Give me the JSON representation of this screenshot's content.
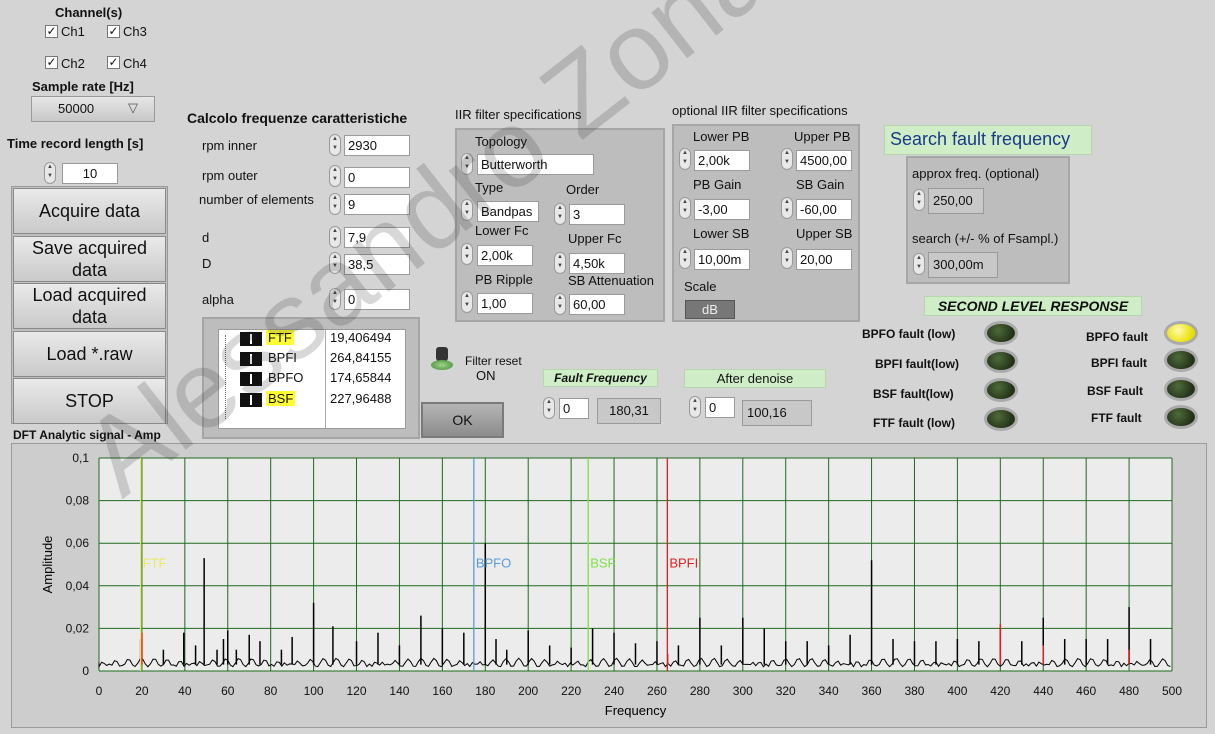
{
  "channels": {
    "title": "Channel(s)",
    "items": [
      {
        "label": "Ch1",
        "checked": true
      },
      {
        "label": "Ch3",
        "checked": true
      },
      {
        "label": "Ch2",
        "checked": true
      },
      {
        "label": "Ch4",
        "checked": true
      }
    ]
  },
  "sample_rate": {
    "label": "Sample rate [Hz]",
    "value": "50000"
  },
  "time_record": {
    "label": "Time record length [s]",
    "value": "10"
  },
  "buttons": {
    "acquire": "Acquire data",
    "save": "Save acquired data",
    "load": "Load acquired data",
    "load_raw": "Load *.raw",
    "stop": "STOP",
    "ok": "OK"
  },
  "calc": {
    "title": "Calcolo frequenze caratteristiche",
    "rpm_inner_label": "rpm inner",
    "rpm_inner": "2930",
    "rpm_outer_label": "rpm outer",
    "rpm_outer": "0",
    "elements_label": "number of elements",
    "elements": "9",
    "d_label": "d",
    "d": "7,9",
    "D_label": "D",
    "D": "38,5",
    "alpha_label": "alpha",
    "alpha": "0"
  },
  "freq_table": [
    {
      "name": "FTF",
      "value": "19,406494",
      "highlight": true
    },
    {
      "name": "BPFI",
      "value": "264,84155",
      "highlight": false
    },
    {
      "name": "BPFO",
      "value": "174,65844",
      "highlight": false
    },
    {
      "name": "BSF",
      "value": "227,96488",
      "highlight": true
    }
  ],
  "iir": {
    "title": "IIR filter specifications",
    "topology_label": "Topology",
    "topology": "Butterworth",
    "type_label": "Type",
    "type": "Bandpas",
    "order_label": "Order",
    "order": "3",
    "lower_fc_label": "Lower Fc",
    "lower_fc": "2,00k",
    "upper_fc_label": "Upper Fc",
    "upper_fc": "4,50k",
    "pb_ripple_label": "PB Ripple",
    "pb_ripple": "1,00",
    "sb_att_label": "SB Attenuation",
    "sb_att": "60,00"
  },
  "opt_iir": {
    "title": "optional IIR filter specifications",
    "lower_pb_label": "Lower PB",
    "lower_pb": "2,00k",
    "upper_pb_label": "Upper PB",
    "upper_pb": "4500,00",
    "pb_gain_label": "PB Gain",
    "pb_gain": "-3,00",
    "sb_gain_label": "SB Gain",
    "sb_gain": "-60,00",
    "lower_sb_label": "Lower SB",
    "lower_sb": "10,00m",
    "upper_sb_label": "Upper SB",
    "upper_sb": "20,00",
    "scale_label": "Scale",
    "scale": "dB"
  },
  "filter_reset": {
    "label": "Filter reset",
    "state": "ON"
  },
  "fault_frequency": {
    "label": "Fault Frequency",
    "index": "0",
    "value": "180,31"
  },
  "after_denoise": {
    "label": "After denoise",
    "index": "0",
    "value": "100,16"
  },
  "search": {
    "title": "Search fault frequency",
    "approx_label": "approx freq. (optional)",
    "approx": "250,00",
    "search_label": "search (+/- % of Fsampl.)",
    "search": "300,00m"
  },
  "second_level": {
    "title": "SECOND LEVEL RESPONSE"
  },
  "leds_low": [
    {
      "label": "BPFO fault (low)",
      "on": false
    },
    {
      "label": "BPFI fault(low)",
      "on": false
    },
    {
      "label": "BSF fault(low)",
      "on": false
    },
    {
      "label": "FTF fault (low)",
      "on": false
    }
  ],
  "leds_high": [
    {
      "label": "BPFO fault",
      "on": true
    },
    {
      "label": "BPFI fault",
      "on": false
    },
    {
      "label": "BSF Fault",
      "on": false
    },
    {
      "label": "FTF fault",
      "on": false
    }
  ],
  "watermark": "Alessandro Zonarini",
  "colors": {
    "ftf": "#e9ea5a",
    "bpfo": "#5b9bd5",
    "bsf": "#7ee04a",
    "bpfi": "#e02020",
    "plot_bg": "#ececec",
    "grid": "#1f6b1f"
  },
  "chart_data": {
    "type": "line",
    "title": "DFT Analytic signal - Amp",
    "xlabel": "Frequency",
    "ylabel": "Amplitude",
    "xlim": [
      0,
      500
    ],
    "ylim": [
      0,
      0.1
    ],
    "xticks": [
      "0",
      "20",
      "40",
      "60",
      "80",
      "100",
      "120",
      "140",
      "160",
      "180",
      "200",
      "220",
      "240",
      "260",
      "280",
      "300",
      "320",
      "340",
      "360",
      "380",
      "400",
      "420",
      "440",
      "460",
      "480",
      "500"
    ],
    "yticks": [
      "0",
      "0,02",
      "0,04",
      "0,06",
      "0,08",
      "0,1"
    ],
    "grid": true,
    "markers": [
      {
        "name": "FTF",
        "x": 19.4,
        "color": "#e9ea5a"
      },
      {
        "name": "BPFO",
        "x": 174.66,
        "color": "#5b9bd5"
      },
      {
        "name": "BSF",
        "x": 227.96,
        "color": "#7ee04a"
      },
      {
        "name": "BPFI",
        "x": 264.84,
        "color": "#e02020"
      }
    ],
    "series": [
      {
        "color": "#000000",
        "x": [
          19.4,
          30,
          39.5,
          45,
          49,
          55,
          58,
          60,
          64,
          70,
          75,
          85,
          90,
          100,
          109,
          120,
          130,
          140,
          150,
          160,
          170,
          180,
          185,
          190,
          200,
          210,
          220,
          230,
          240,
          250,
          260,
          270,
          280,
          290,
          300,
          310,
          320,
          330,
          340,
          350,
          360,
          370,
          380,
          390,
          400,
          410,
          420,
          430,
          440,
          450,
          460,
          470,
          480,
          490
        ],
        "values": [
          0.015,
          0.01,
          0.018,
          0.012,
          0.053,
          0.01,
          0.015,
          0.019,
          0.01,
          0.017,
          0.014,
          0.01,
          0.016,
          0.032,
          0.021,
          0.014,
          0.018,
          0.012,
          0.026,
          0.02,
          0.018,
          0.06,
          0.015,
          0.01,
          0.019,
          0.012,
          0.011,
          0.02,
          0.018,
          0.013,
          0.014,
          0.012,
          0.025,
          0.012,
          0.025,
          0.02,
          0.014,
          0.014,
          0.012,
          0.017,
          0.052,
          0.015,
          0.014,
          0.014,
          0.015,
          0.014,
          0.02,
          0.014,
          0.025,
          0.015,
          0.015,
          0.015,
          0.03,
          0.015
        ]
      },
      {
        "color": "#e02020",
        "x": [
          20,
          265,
          420,
          440,
          480
        ],
        "values": [
          0.018,
          0.008,
          0.022,
          0.012,
          0.01
        ]
      }
    ]
  }
}
